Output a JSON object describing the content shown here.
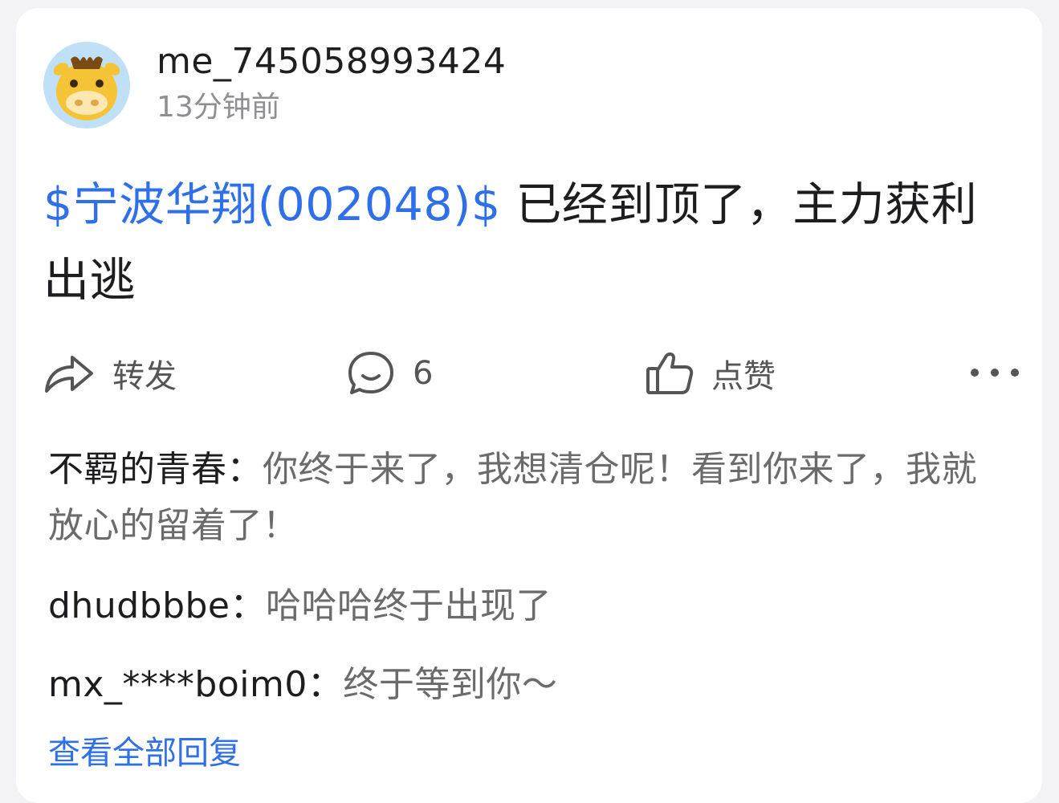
{
  "author": {
    "name": "me_745058993424",
    "time": "13分钟前"
  },
  "post": {
    "stock_tag": "$宁波华翔(002048)$",
    "text": " 已经到顶了，主力获利出逃"
  },
  "actions": {
    "share_label": "转发",
    "comment_count": "6",
    "like_label": "点赞",
    "share_icon": "share-arrow-icon",
    "comment_icon": "comment-bubble-icon",
    "like_icon": "thumbs-up-icon",
    "more_icon": "more-dots-icon"
  },
  "comments": [
    {
      "author": "不羁的青春",
      "sep": "：",
      "text": "你终于来了，我想清仓呢！看到你来了，我就放心的留着了！"
    },
    {
      "author": "dhudbbbe",
      "sep": "：",
      "text": "哈哈哈终于出现了"
    },
    {
      "author": "mx_****boim0",
      "sep": "：",
      "text": "终于等到你～"
    }
  ],
  "view_all_label": "查看全部回复",
  "colors": {
    "link": "#2f6fe8",
    "avatar_bg": "#bfe0f7",
    "avatar_face": "#f5c436"
  }
}
